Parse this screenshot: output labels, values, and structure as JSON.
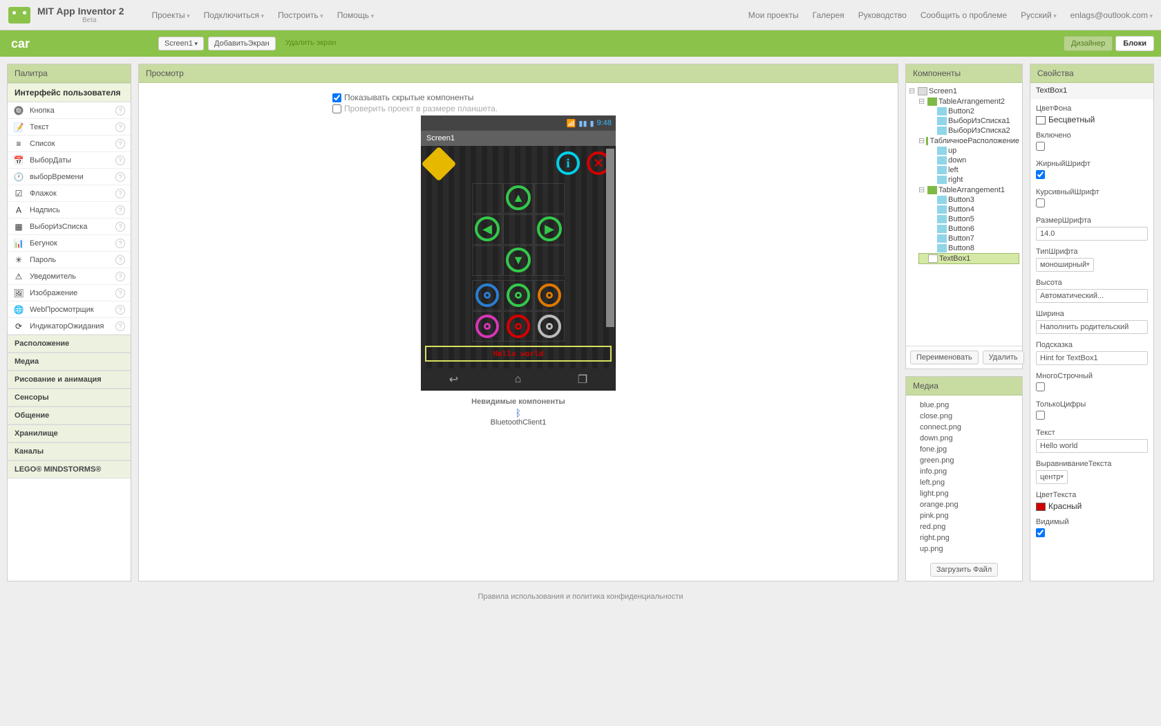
{
  "header": {
    "app_title": "MIT App Inventor 2",
    "beta": "Beta",
    "menus": [
      "Проекты",
      "Подключиться",
      "Построить",
      "Помощь"
    ],
    "right_menus": [
      {
        "label": "Мои проекты",
        "caret": false
      },
      {
        "label": "Галерея",
        "caret": false
      },
      {
        "label": "Руководство",
        "caret": false
      },
      {
        "label": "Сообщить о проблеме",
        "caret": false
      },
      {
        "label": "Русский",
        "caret": true
      },
      {
        "label": "enlags@outlook.com",
        "caret": true
      }
    ]
  },
  "greenbar": {
    "project": "car",
    "screen_btn": "Screen1",
    "add_screen": "ДобавитьЭкран",
    "del_screen": "Удалить экран",
    "designer": "Дизайнер",
    "blocks": "Блоки"
  },
  "palette": {
    "title": "Палитра",
    "active_cat": "Интерфейс пользователя",
    "items": [
      {
        "icon": "🔘",
        "label": "Кнопка"
      },
      {
        "icon": "📝",
        "label": "Текст"
      },
      {
        "icon": "≡",
        "label": "Список"
      },
      {
        "icon": "📅",
        "label": "ВыборДаты"
      },
      {
        "icon": "🕐",
        "label": "выборВремени"
      },
      {
        "icon": "☑",
        "label": "Флажок"
      },
      {
        "icon": "A",
        "label": "Надпись"
      },
      {
        "icon": "▦",
        "label": "ВыборИзСписка"
      },
      {
        "icon": "📊",
        "label": "Бегунок"
      },
      {
        "icon": "✳",
        "label": "Пароль"
      },
      {
        "icon": "⚠",
        "label": "Уведомитель"
      },
      {
        "icon": "🖼",
        "label": "Изображение"
      },
      {
        "icon": "🌐",
        "label": "WebПросмотрщик"
      },
      {
        "icon": "⟳",
        "label": "ИндикаторОжидания"
      }
    ],
    "cats": [
      "Расположение",
      "Медиа",
      "Рисование и анимация",
      "Сенсоры",
      "Общение",
      "Хранилище",
      "Каналы",
      "LEGO® MINDSTORMS®"
    ]
  },
  "viewer": {
    "title": "Просмотр",
    "chk_hidden": "Показывать скрытые компоненты",
    "chk_tablet": "Проверить проект в размере планшета.",
    "statusbar_time": "9:48",
    "screen_title": "Screen1",
    "hello": "Hello world",
    "invisible_heading": "Невидимые компоненты",
    "bt_client": "BluetoothClient1"
  },
  "components": {
    "title": "Компоненты",
    "tree": [
      {
        "ic": "scr",
        "label": "Screen1",
        "ind": 0,
        "exp": true
      },
      {
        "ic": "tbl",
        "label": "TableArrangement2",
        "ind": 1,
        "exp": true
      },
      {
        "ic": "but",
        "label": "Button2",
        "ind": 2
      },
      {
        "ic": "but",
        "label": "ВыборИзСписка1",
        "ind": 2
      },
      {
        "ic": "but",
        "label": "ВыборИзСписка2",
        "ind": 2
      },
      {
        "ic": "tbl",
        "label": "ТабличноеРасположение",
        "ind": 1,
        "exp": true
      },
      {
        "ic": "but",
        "label": "up",
        "ind": 2
      },
      {
        "ic": "but",
        "label": "down",
        "ind": 2
      },
      {
        "ic": "but",
        "label": "left",
        "ind": 2
      },
      {
        "ic": "but",
        "label": "right",
        "ind": 2
      },
      {
        "ic": "tbl",
        "label": "TableArrangement1",
        "ind": 1,
        "exp": true
      },
      {
        "ic": "but",
        "label": "Button3",
        "ind": 2
      },
      {
        "ic": "but",
        "label": "Button4",
        "ind": 2
      },
      {
        "ic": "but",
        "label": "Button5",
        "ind": 2
      },
      {
        "ic": "but",
        "label": "Button6",
        "ind": 2
      },
      {
        "ic": "but",
        "label": "Button7",
        "ind": 2
      },
      {
        "ic": "but",
        "label": "Button8",
        "ind": 2
      },
      {
        "ic": "txt",
        "label": "TextBox1",
        "ind": 1,
        "sel": true
      }
    ],
    "rename": "Переименовать",
    "delete": "Удалить"
  },
  "media": {
    "title": "Медиа",
    "files": [
      "blue.png",
      "close.png",
      "connect.png",
      "down.png",
      "fone.jpg",
      "green.png",
      "info.png",
      "left.png",
      "light.png",
      "orange.png",
      "pink.png",
      "red.png",
      "right.png",
      "up.png"
    ],
    "upload": "Загрузить Файл"
  },
  "properties": {
    "title": "Свойства",
    "component": "TextBox1",
    "items": [
      {
        "type": "color",
        "label": "ЦветФона",
        "swatch": "#fff",
        "value": "Бесцветный"
      },
      {
        "type": "check",
        "label": "Включено",
        "checked": false
      },
      {
        "type": "check",
        "label": "ЖирныйШрифт",
        "checked": true
      },
      {
        "type": "check",
        "label": "КурсивныйШрифт",
        "checked": false
      },
      {
        "type": "input",
        "label": "РазмерШрифта",
        "value": "14.0"
      },
      {
        "type": "select",
        "label": "ТипШрифта",
        "value": "моноширный"
      },
      {
        "type": "selectw",
        "label": "Высота",
        "value": "Автоматический..."
      },
      {
        "type": "selectw",
        "label": "Ширина",
        "value": "Наполнить родительский"
      },
      {
        "type": "input",
        "label": "Подсказка",
        "value": "Hint for TextBox1"
      },
      {
        "type": "check",
        "label": "МногоСтрочный",
        "checked": false
      },
      {
        "type": "check",
        "label": "ТолькоЦифры",
        "checked": false
      },
      {
        "type": "input",
        "label": "Текст",
        "value": "Hello world"
      },
      {
        "type": "select",
        "label": "ВыравниваниеТекста",
        "value": "центр"
      },
      {
        "type": "color",
        "label": "ЦветТекста",
        "swatch": "#d40000",
        "value": "Красный"
      },
      {
        "type": "check",
        "label": "Видимый",
        "checked": true
      }
    ]
  },
  "footer": "Правила использования и политика конфиденциальности"
}
